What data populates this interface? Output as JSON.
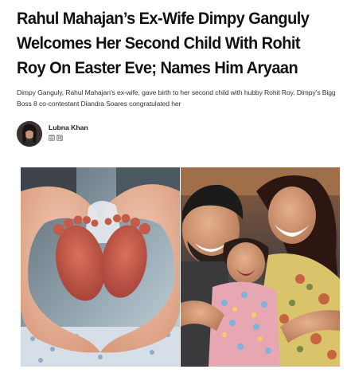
{
  "article": {
    "headline": "Rahul Mahajan’s Ex-Wife Dimpy Ganguly Welcomes Her Second Child With Rohit Roy On Easter Eve; Names Him Aryaan",
    "summary": "Dimpy Ganguly, Rahul Mahajan’s ex-wife, gave birth to her second child with hubby Rohit Roy. Dimpy’s Bigg Boss 8 co-contestant Diandra Soares congratulated her",
    "author": {
      "name": "Lubna Khan",
      "share_icons": [
        "email-icon",
        "copy-link-icon"
      ]
    },
    "images": [
      {
        "name": "baby-feet-photo"
      },
      {
        "name": "family-selfie-photo"
      }
    ]
  },
  "colors": {
    "text": "#111111",
    "summary_text": "#333333",
    "icon_gray": "#9a9a9a"
  }
}
